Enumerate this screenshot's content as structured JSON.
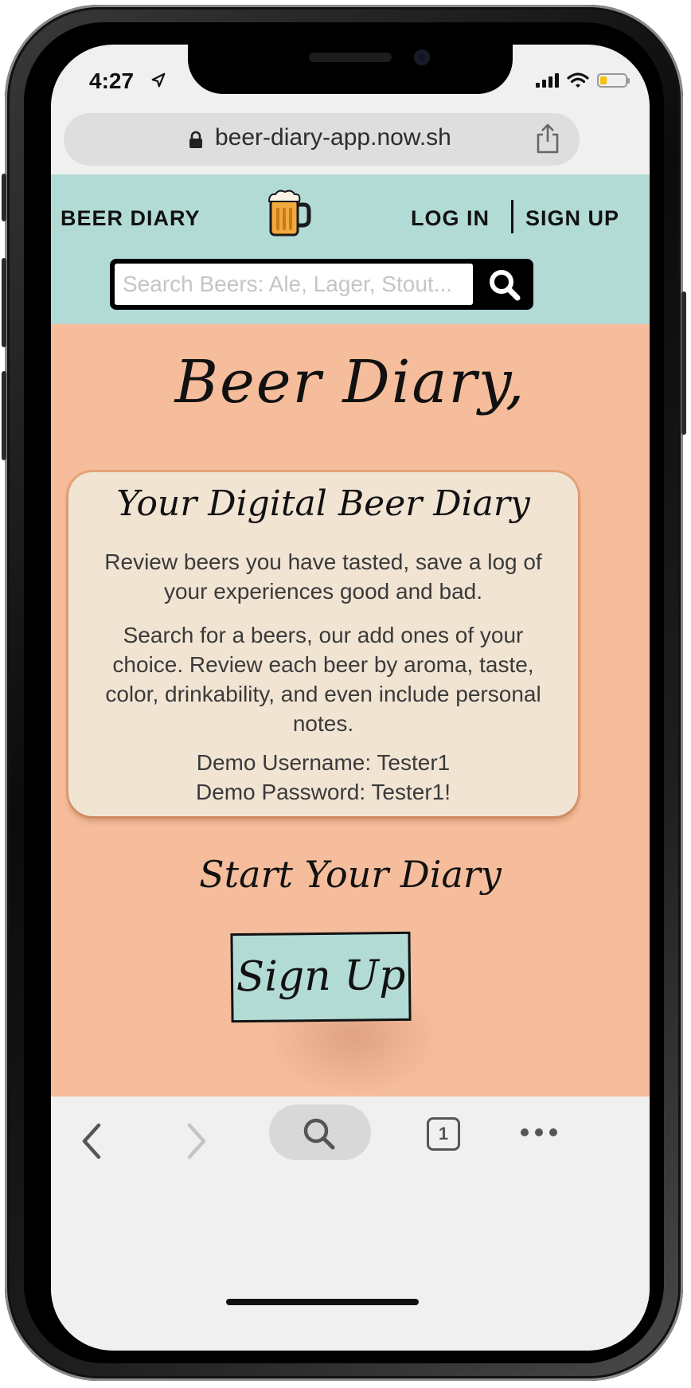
{
  "status_bar": {
    "time": "4:27"
  },
  "browser": {
    "url": "beer-diary-app.now.sh"
  },
  "header": {
    "brand": "BEER DIARY",
    "login": "LOG IN",
    "signup": "SIGN UP",
    "search_placeholder": "Search Beers: Ale, Lager, Stout..."
  },
  "main": {
    "hero_title": "Beer Diary,",
    "card": {
      "title": "Your Digital Beer Diary",
      "paragraph1": "Review beers you have tasted, save a log of your experiences good and bad.",
      "paragraph2": "Search for a beers, our add ones of your choice. Review each beer by aroma, taste, color, drinkability, and even include personal notes.",
      "demo_username": "Demo Username: Tester1",
      "demo_password": "Demo Password: Tester1!"
    },
    "start_heading": "Start Your Diary",
    "signup_button": "Sign Up"
  },
  "toolbar": {
    "tab_count": "1"
  },
  "colors": {
    "header_bg": "#b3dbd6",
    "main_bg": "#f5bd9b",
    "card_bg": "#f2e4d3",
    "button_bg": "#b3dbd6"
  }
}
